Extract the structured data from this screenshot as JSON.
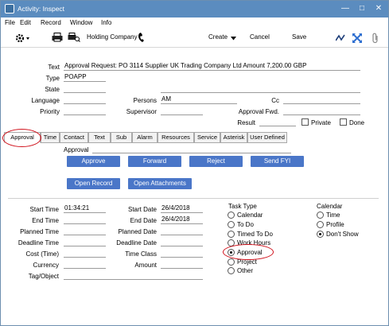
{
  "window": {
    "title": "Activity: Inspect"
  },
  "menu": [
    "File",
    "Edit",
    "Record",
    "Window",
    "Info"
  ],
  "toolbar": {
    "company": "Holding Company",
    "create": "Create",
    "cancel": "Cancel",
    "save": "Save"
  },
  "header": {
    "text_label": "Text",
    "text_value": "Approval Request: PO 3114 Supplier UK Trading Company Ltd Amount 7,200.00 GBP",
    "type_label": "Type",
    "type_value": "POAPP",
    "state_label": "State",
    "language_label": "Language",
    "persons_label": "Persons",
    "persons_value": "AM",
    "cc_label": "Cc",
    "priority_label": "Priority",
    "supervisor_label": "Supervisor",
    "approval_fwd_label": "Approval Fwd.",
    "result_label": "Result",
    "private_label": "Private",
    "done_label": "Done"
  },
  "tabs": [
    "Approval",
    "Time",
    "Contact",
    "Text",
    "Sub",
    "Alarm",
    "Resources",
    "Service",
    "Asterisk",
    "User Defined"
  ],
  "approval": {
    "approval_label": "Approval",
    "buttons": [
      "Approve",
      "Forward",
      "Reject",
      "Send FYI"
    ],
    "buttons2": [
      "Open Record",
      "Open Attachments"
    ]
  },
  "lower": {
    "start_time_label": "Start Time",
    "start_time_value": "01:34:21",
    "end_time_label": "End Time",
    "planned_time_label": "Planned Time",
    "deadline_time_label": "Deadline Time",
    "cost_label": "Cost (Time)",
    "currency_label": "Currency",
    "tag_label": "Tag/Object",
    "start_date_label": "Start Date",
    "start_date_value": "26/4/2018",
    "end_date_label": "End Date",
    "end_date_value": "26/4/2018",
    "planned_date_label": "Planned Date",
    "deadline_date_label": "Deadline Date",
    "time_class_label": "Time Class",
    "amount_label": "Amount"
  },
  "task_type": {
    "title": "Task Type",
    "options": [
      "Calendar",
      "To Do",
      "Timed To Do",
      "Work Hours",
      "Approval",
      "Project",
      "Other"
    ],
    "selected": "Approval"
  },
  "calendar": {
    "title": "Calendar",
    "options": [
      "Time",
      "Profile",
      "Don't Show"
    ],
    "selected": "Don't Show"
  },
  "colors": {
    "titlebar": "#5b8cbf",
    "button": "#4a76c8",
    "highlight": "#d0121c"
  }
}
